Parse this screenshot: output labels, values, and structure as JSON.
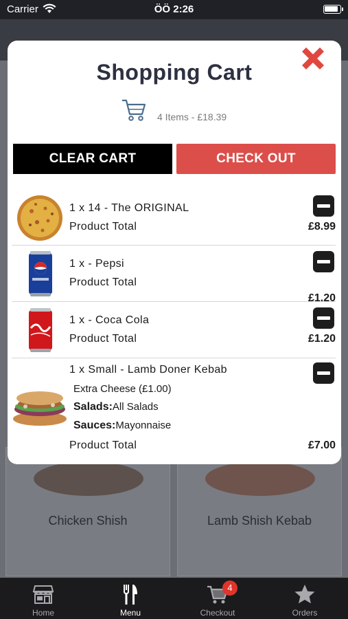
{
  "status": {
    "carrier": "Carrier",
    "time": "ÖÖ 2:26"
  },
  "background": {
    "cards": [
      "Chicken Shish",
      "Lamb Shish Kebab"
    ]
  },
  "cart": {
    "title": "Shopping Cart",
    "summary": "4 Items - £18.39",
    "clear_label": "CLEAR CART",
    "checkout_label": "CHECK OUT",
    "items": [
      {
        "name": "1 x 14 - The ORIGINAL",
        "total_label": "Product Total",
        "price": "£8.99",
        "image": "pizza"
      },
      {
        "name": "1 x - Pepsi",
        "total_label": "Product Total",
        "price": "£1.20",
        "image": "pepsi-can"
      },
      {
        "name": "1 x - Coca Cola",
        "total_label": "Product Total",
        "price": "£1.20",
        "image": "coca-cola-can"
      },
      {
        "name": "1 x Small - Lamb Doner Kebab",
        "extra": "Extra Cheese (£1.00)",
        "salads_label": "Salads:",
        "salads_value": "All Salads",
        "sauces_label": "Sauces:",
        "sauces_value": "Mayonnaise",
        "total_label": "Product Total",
        "price": "£7.00",
        "image": "kebab-wrap"
      }
    ]
  },
  "tabbar": {
    "items": [
      {
        "label": "Home",
        "icon": "store-icon"
      },
      {
        "label": "Menu",
        "icon": "fork-knife-icon"
      },
      {
        "label": "Checkout",
        "icon": "cart-icon",
        "badge": "4"
      },
      {
        "label": "Orders",
        "icon": "star-icon"
      }
    ]
  },
  "colors": {
    "checkout": "#dc4e4a",
    "close": "#e0473f",
    "badge": "#e0352b"
  }
}
